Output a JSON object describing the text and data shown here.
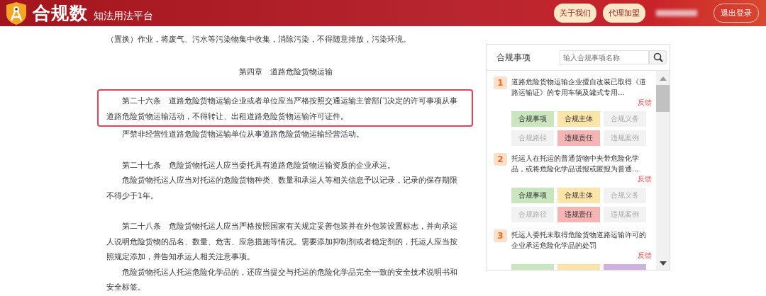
{
  "header": {
    "brand": "合规数",
    "subtitle": "知法用法平台",
    "buttons": [
      {
        "label": "关于我们",
        "kind": "pill"
      },
      {
        "label": "代理加盟",
        "kind": "pill"
      },
      {
        "label": "退出登录",
        "kind": "outline"
      }
    ]
  },
  "document": {
    "paragraphs": [
      {
        "kind": "continuation",
        "text": "（置换）作业，将废气、污水等污染物集中收集，消除污染，不得随意排放，污染环境。"
      },
      {
        "kind": "heading",
        "text": "第四章　道路危险货物运输"
      },
      {
        "kind": "highlighted",
        "text": "第二十六条　道路危险货物运输企业或者单位应当严格按照交通运输主管部门决定的许可事项从事道路危险货物运输活动，不得转让、出租道路危险货物运输许可证件。"
      },
      {
        "kind": "paragraph",
        "text": "严禁非经营性道路危险货物运输单位从事道路危险货物运输经营活动。"
      },
      {
        "kind": "spaced",
        "text": "第二十七条　危险货物托运人应当委托具有道路危险货物运输资质的企业承运。"
      },
      {
        "kind": "paragraph",
        "text": "危险货物托运人应当对托运的危险货物种类、数量和承运人等相关信息予以记录，记录的保存期限不得少于1年。"
      },
      {
        "kind": "spaced",
        "text": "第二十八条　危险货物托运人应当严格按照国家有关规定妥善包装并在外包装设置标志，并向承运人说明危险货物的品名、数量、危害、应急措施等情况。需要添加抑制剂或者稳定剂的，托运人应当按照规定添加，并告知承运人相关注意事项。"
      },
      {
        "kind": "paragraph",
        "text": "危险货物托运人托运危险化学品的，还应当提交与托运的危险化学品完全一致的安全技术说明书和安全标签。"
      }
    ]
  },
  "sidebar": {
    "title": "合规事项",
    "search": {
      "placeholder": "输入合规事项名称"
    },
    "items": [
      {
        "number": "1",
        "title": "道路危险货物运输企业擅自改装已取得《道路运输证》的专用车辆及罐式专用...",
        "feedback": "反馈",
        "tags": [
          {
            "label": "合规事项",
            "color": "#c9e6bf",
            "enabled": true
          },
          {
            "label": "合规主体",
            "color": "#fde4a8",
            "enabled": true
          },
          {
            "label": "合规义务",
            "color": "#f2f2f2",
            "enabled": false
          },
          {
            "label": "合规路径",
            "color": "#f2f2f2",
            "enabled": false
          },
          {
            "label": "违规责任",
            "color": "#f5b5b5",
            "enabled": true
          },
          {
            "label": "违规案例",
            "color": "#f2f2f2",
            "enabled": false
          }
        ]
      },
      {
        "number": "2",
        "title": "托运人在托运的普通货物中夹带危险化学品，或将危险化学品谎报或匿报为普通...",
        "feedback": "反馈",
        "tags": [
          {
            "label": "合规事项",
            "color": "#c9e6bf",
            "enabled": true
          },
          {
            "label": "合规主体",
            "color": "#fde4a8",
            "enabled": true
          },
          {
            "label": "合规义务",
            "color": "#f2f2f2",
            "enabled": false
          },
          {
            "label": "合规路径",
            "color": "#f2f2f2",
            "enabled": false
          },
          {
            "label": "违规责任",
            "color": "#f5b5b5",
            "enabled": true
          },
          {
            "label": "违规案例",
            "color": "#f2f2f2",
            "enabled": false
          }
        ]
      },
      {
        "number": "3",
        "title": "托运人委托未取得危险货物道路运输许可的企业承运危险化学品的处罚",
        "feedback": "反馈",
        "tags": [
          {
            "color": "#c9e6bf"
          },
          {
            "color": "#fde4a8"
          },
          {
            "color": "#cfb3dc"
          }
        ]
      }
    ]
  }
}
